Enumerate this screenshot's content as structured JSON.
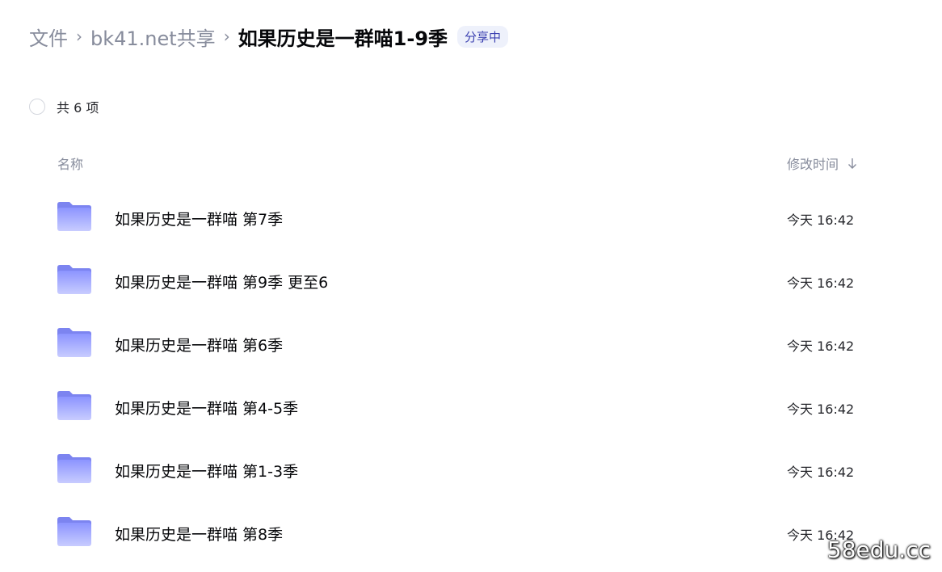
{
  "breadcrumb": {
    "items": [
      "文件",
      "bk41.net共享"
    ],
    "separator": "›",
    "current": "如果历史是一群喵1-9季",
    "badge": "分享中"
  },
  "selection": {
    "count_text": "共 6 项"
  },
  "columns": {
    "name": "名称",
    "modified": "修改时间",
    "sort_icon": "arrow-down-icon"
  },
  "files": [
    {
      "name": "如果历史是一群喵 第7季",
      "time": "今天 16:42",
      "icon": "folder-icon"
    },
    {
      "name": "如果历史是一群喵 第9季 更至6",
      "time": "今天 16:42",
      "icon": "folder-icon"
    },
    {
      "name": "如果历史是一群喵 第6季",
      "time": "今天 16:42",
      "icon": "folder-icon"
    },
    {
      "name": "如果历史是一群喵 第4-5季",
      "time": "今天 16:42",
      "icon": "folder-icon"
    },
    {
      "name": "如果历史是一群喵 第1-3季",
      "time": "今天 16:42",
      "icon": "folder-icon"
    },
    {
      "name": "如果历史是一群喵 第8季",
      "time": "今天 16:42",
      "icon": "folder-icon"
    }
  ],
  "watermark": "58edu.cc",
  "colors": {
    "folder_top": "#8c94ff",
    "folder_bottom": "#c8ccff",
    "badge_bg": "#eef1fb",
    "muted_text": "#878c9c"
  }
}
